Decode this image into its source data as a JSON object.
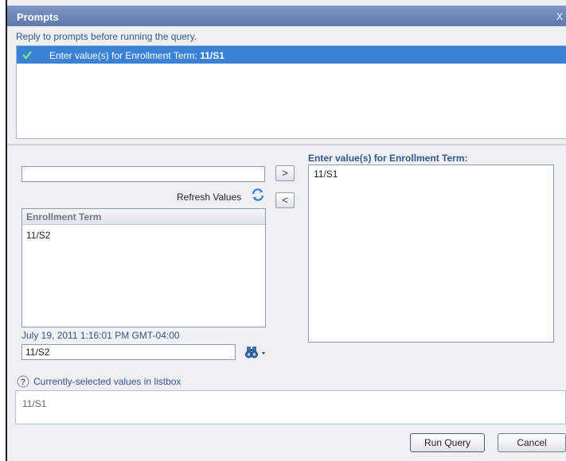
{
  "window": {
    "title": "Prompts",
    "close_label": "X"
  },
  "instruction": "Reply to prompts before running the query.",
  "prompt_list": {
    "items": [
      {
        "label": "Enter value(s) for Enrollment Term: ",
        "value": "11/S1",
        "status_icon": "check-icon",
        "selected": true
      }
    ]
  },
  "available": {
    "search_value": "",
    "add_label": ">",
    "remove_label": "<",
    "refresh_label": "Refresh Values",
    "column_header": "Enrollment Term",
    "items": [
      "11/S2"
    ],
    "timestamp": "July 19, 2011 1:16:01 PM GMT-04:00",
    "value_input": "11/S2"
  },
  "selected": {
    "heading": "Enter value(s) for Enrollment Term:",
    "items": [
      "11/S1"
    ]
  },
  "current": {
    "help_text": "Currently-selected values in listbox",
    "value": "11/S1"
  },
  "buttons": {
    "run_query": "Run Query",
    "cancel": "Cancel"
  },
  "colors": {
    "title_bar": "#6a84b8",
    "selection": "#3b82d6",
    "link_text": "#35558c",
    "check": "#2e9a2e"
  }
}
